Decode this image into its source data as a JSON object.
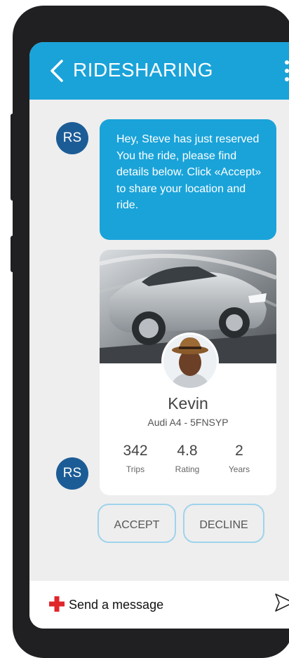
{
  "app": {
    "title": "RIDESHARING"
  },
  "sender": {
    "initials": "RS"
  },
  "message": {
    "text": "Hey, Steve has just reserved You the ride, please find details below. Click «Accept» to share your location and ride."
  },
  "driver": {
    "name": "Kevin",
    "car": "Audi A4 - 5FNSYP",
    "stats": [
      {
        "value": "342",
        "label": "Trips"
      },
      {
        "value": "4.8",
        "label": "Rating"
      },
      {
        "value": "2",
        "label": "Years"
      }
    ]
  },
  "actions": {
    "accept_label": "ACCEPT",
    "decline_label": "DECLINE"
  },
  "composer": {
    "placeholder": "Send a message"
  },
  "colors": {
    "accent": "#1aa3d9",
    "avatar": "#1c5c96",
    "add": "#e0262b"
  },
  "icons": {
    "back": "chevron-left-icon",
    "menu": "more-vertical-icon",
    "add": "plus-icon",
    "send": "send-icon"
  }
}
